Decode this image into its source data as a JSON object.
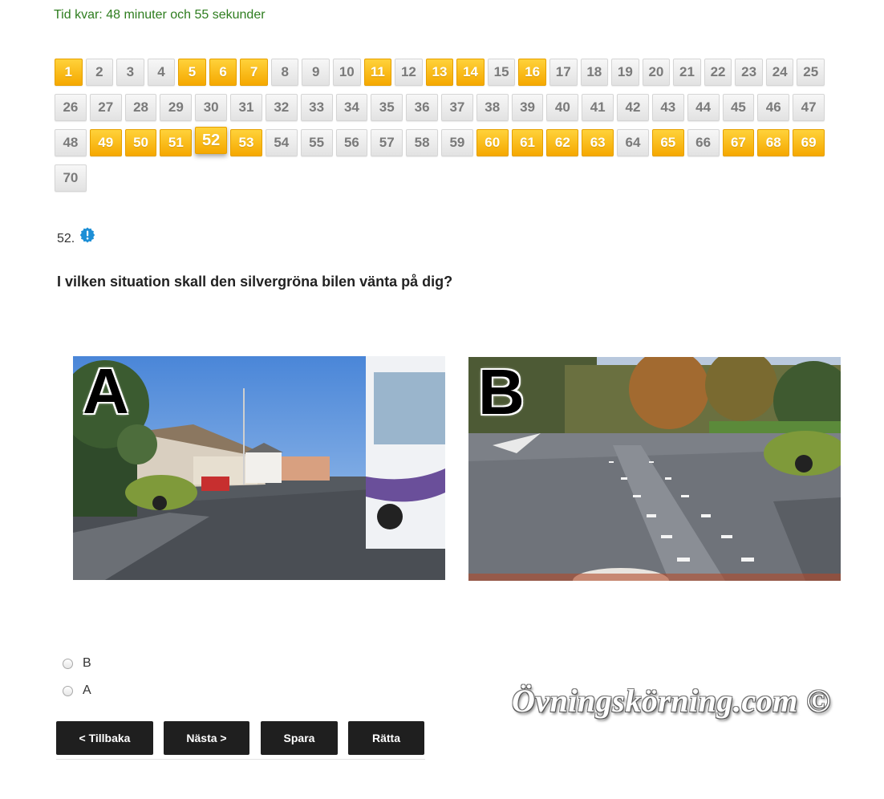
{
  "timer": {
    "text": "Tid kvar: 48 minuter och 55 sekunder"
  },
  "question_nav": {
    "buttons": [
      {
        "n": "1",
        "state": "answered"
      },
      {
        "n": "2",
        "state": "open"
      },
      {
        "n": "3",
        "state": "open"
      },
      {
        "n": "4",
        "state": "open"
      },
      {
        "n": "5",
        "state": "answered"
      },
      {
        "n": "6",
        "state": "answered"
      },
      {
        "n": "7",
        "state": "answered"
      },
      {
        "n": "8",
        "state": "open"
      },
      {
        "n": "9",
        "state": "open"
      },
      {
        "n": "10",
        "state": "open"
      },
      {
        "n": "11",
        "state": "answered"
      },
      {
        "n": "12",
        "state": "open"
      },
      {
        "n": "13",
        "state": "answered"
      },
      {
        "n": "14",
        "state": "answered"
      },
      {
        "n": "15",
        "state": "open"
      },
      {
        "n": "16",
        "state": "answered"
      },
      {
        "n": "17",
        "state": "open"
      },
      {
        "n": "18",
        "state": "open"
      },
      {
        "n": "19",
        "state": "open"
      },
      {
        "n": "20",
        "state": "open"
      },
      {
        "n": "21",
        "state": "open"
      },
      {
        "n": "22",
        "state": "open"
      },
      {
        "n": "23",
        "state": "open"
      },
      {
        "n": "24",
        "state": "open"
      },
      {
        "n": "25",
        "state": "open"
      },
      {
        "n": "26",
        "state": "open"
      },
      {
        "n": "27",
        "state": "open"
      },
      {
        "n": "28",
        "state": "open"
      },
      {
        "n": "29",
        "state": "open"
      },
      {
        "n": "30",
        "state": "open"
      },
      {
        "n": "31",
        "state": "open"
      },
      {
        "n": "32",
        "state": "open"
      },
      {
        "n": "33",
        "state": "open"
      },
      {
        "n": "34",
        "state": "open"
      },
      {
        "n": "35",
        "state": "open"
      },
      {
        "n": "36",
        "state": "open"
      },
      {
        "n": "37",
        "state": "open"
      },
      {
        "n": "38",
        "state": "open"
      },
      {
        "n": "39",
        "state": "open"
      },
      {
        "n": "40",
        "state": "open"
      },
      {
        "n": "41",
        "state": "open"
      },
      {
        "n": "42",
        "state": "open"
      },
      {
        "n": "43",
        "state": "open"
      },
      {
        "n": "44",
        "state": "open"
      },
      {
        "n": "45",
        "state": "open"
      },
      {
        "n": "46",
        "state": "open"
      },
      {
        "n": "47",
        "state": "open"
      },
      {
        "n": "48",
        "state": "open"
      },
      {
        "n": "49",
        "state": "answered"
      },
      {
        "n": "50",
        "state": "answered"
      },
      {
        "n": "51",
        "state": "answered"
      },
      {
        "n": "52",
        "state": "current"
      },
      {
        "n": "53",
        "state": "answered"
      },
      {
        "n": "54",
        "state": "open"
      },
      {
        "n": "55",
        "state": "open"
      },
      {
        "n": "56",
        "state": "open"
      },
      {
        "n": "57",
        "state": "open"
      },
      {
        "n": "58",
        "state": "open"
      },
      {
        "n": "59",
        "state": "open"
      },
      {
        "n": "60",
        "state": "answered"
      },
      {
        "n": "61",
        "state": "answered"
      },
      {
        "n": "62",
        "state": "answered"
      },
      {
        "n": "63",
        "state": "answered"
      },
      {
        "n": "64",
        "state": "open"
      },
      {
        "n": "65",
        "state": "answered"
      },
      {
        "n": "66",
        "state": "open"
      },
      {
        "n": "67",
        "state": "answered"
      },
      {
        "n": "68",
        "state": "answered"
      },
      {
        "n": "69",
        "state": "answered"
      },
      {
        "n": "70",
        "state": "open"
      }
    ],
    "colors": {
      "answered": "#f5a800",
      "open": "#e6e6e6",
      "text_open": "#7a7a7a"
    }
  },
  "question": {
    "number": "52.",
    "info_icon": "info-badge-icon",
    "text": "I vilken situation skall den silvergröna bilen vänta på dig?",
    "images": [
      {
        "label": "A"
      },
      {
        "label": "B"
      }
    ]
  },
  "options": [
    {
      "label": "B",
      "selected": false
    },
    {
      "label": "A",
      "selected": false
    }
  ],
  "watermark": "Övningskörning.com ©",
  "buttons": {
    "back": "< Tillbaka",
    "next": "Nästa >",
    "save": "Spara",
    "grade": "Rätta"
  }
}
